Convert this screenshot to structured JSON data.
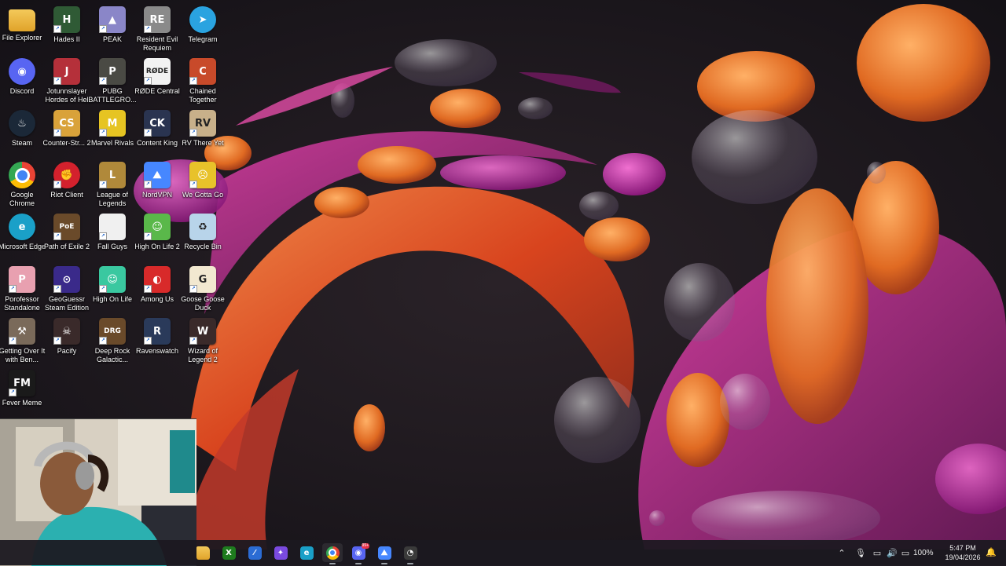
{
  "desktop": {
    "icons": [
      {
        "label": "File Explorer",
        "icon": "folder-icon",
        "color": "#e8b43a",
        "glyph": ""
      },
      {
        "label": "Hades II",
        "icon": "hades-icon",
        "color": "#2f5a35",
        "glyph": "H"
      },
      {
        "label": "PEAK",
        "icon": "peak-icon",
        "color": "#8a86c8",
        "glyph": "▲"
      },
      {
        "label": "Resident Evil Requiem",
        "icon": "resident-evil-icon",
        "color": "#8a8a8a",
        "glyph": "RE"
      },
      {
        "label": "Telegram",
        "icon": "telegram-icon",
        "color": "#2aa3e0",
        "glyph": "➤"
      },
      {
        "label": "Discord",
        "icon": "discord-icon",
        "color": "#5865f2",
        "glyph": "◉"
      },
      {
        "label": "Jotunnslayer Hordes of Hel",
        "icon": "jotunnslayer-icon",
        "color": "#b5303a",
        "glyph": "J"
      },
      {
        "label": "PUBG BATTLEGRO...",
        "icon": "pubg-icon",
        "color": "#4a4a44",
        "glyph": "P"
      },
      {
        "label": "RØDE Central",
        "icon": "rode-icon",
        "color": "#f2f2f2",
        "glyph": "RØDE"
      },
      {
        "label": "Chained Together",
        "icon": "chained-together-icon",
        "color": "#c84a2a",
        "glyph": "C"
      },
      {
        "label": "Steam",
        "icon": "steam-icon",
        "color": "#1b2838",
        "glyph": "♨"
      },
      {
        "label": "Counter-Str... 2",
        "icon": "counter-strike-icon",
        "color": "#d9a23a",
        "glyph": "CS"
      },
      {
        "label": "Marvel Rivals",
        "icon": "marvel-rivals-icon",
        "color": "#e6c422",
        "glyph": "M"
      },
      {
        "label": "Content King",
        "icon": "content-king-icon",
        "color": "#2a3450",
        "glyph": "CK"
      },
      {
        "label": "RV There Yet",
        "icon": "rv-there-yet-icon",
        "color": "#c8b08a",
        "glyph": "RV"
      },
      {
        "label": "Google Chrome",
        "icon": "chrome-icon",
        "color": "#ffffff",
        "glyph": ""
      },
      {
        "label": "Riot Client",
        "icon": "riot-client-icon",
        "color": "#d3212d",
        "glyph": "✊"
      },
      {
        "label": "League of Legends",
        "icon": "league-of-legends-icon",
        "color": "#b0893a",
        "glyph": "L"
      },
      {
        "label": "NordVPN",
        "icon": "nordvpn-icon",
        "color": "#4687ff",
        "glyph": "⛰"
      },
      {
        "label": "We Gotta Go",
        "icon": "we-gotta-go-icon",
        "color": "#e8c22a",
        "glyph": "☹"
      },
      {
        "label": "Microsoft Edge",
        "icon": "edge-icon",
        "color": "#1aa0c8",
        "glyph": "e"
      },
      {
        "label": "Path of Exile 2",
        "icon": "path-of-exile-icon",
        "color": "#6a4a2a",
        "glyph": "PoE"
      },
      {
        "label": "Fall Guys",
        "icon": "fall-guys-icon",
        "color": "#f0f0f0",
        "glyph": ""
      },
      {
        "label": "High On Life 2",
        "icon": "high-on-life-2-icon",
        "color": "#5ab84a",
        "glyph": "☺"
      },
      {
        "label": "Recycle Bin",
        "icon": "recycle-bin-icon",
        "color": "#b8d4ea",
        "glyph": "♻"
      },
      {
        "label": "Porofessor Standalone",
        "icon": "porofessor-icon",
        "color": "#e8a0b0",
        "glyph": "P"
      },
      {
        "label": "GeoGuessr Steam Edition",
        "icon": "geoguessr-icon",
        "color": "#3a2a8a",
        "glyph": "⊙"
      },
      {
        "label": "High On Life",
        "icon": "high-on-life-icon",
        "color": "#3ac8a0",
        "glyph": "☺"
      },
      {
        "label": "Among Us",
        "icon": "among-us-icon",
        "color": "#d82a2a",
        "glyph": "◐"
      },
      {
        "label": "Goose Goose Duck",
        "icon": "goose-goose-duck-icon",
        "color": "#f2e8d0",
        "glyph": "G"
      },
      {
        "label": "Getting Over It with Ben...",
        "icon": "getting-over-it-icon",
        "color": "#7a6a5a",
        "glyph": "⚒"
      },
      {
        "label": "Pacify",
        "icon": "pacify-icon",
        "color": "#3a2a2a",
        "glyph": "☠"
      },
      {
        "label": "Deep Rock Galactic...",
        "icon": "deep-rock-galactic-icon",
        "color": "#6a4a2a",
        "glyph": "DRG"
      },
      {
        "label": "Ravenswatch",
        "icon": "ravenswatch-icon",
        "color": "#2a3a5a",
        "glyph": "R"
      },
      {
        "label": "Wizard of Legend 2",
        "icon": "wizard-of-legend-icon",
        "color": "#3a2a2a",
        "glyph": "W"
      },
      {
        "label": "Fever Meme",
        "icon": "fever-meme-icon",
        "color": "#1a1a1a",
        "glyph": "FM"
      }
    ]
  },
  "taskbar": {
    "apps": [
      {
        "name": "File Explorer",
        "icon": "file-explorer-taskbar-icon",
        "color": "#e8b43a",
        "glyph": "",
        "running": false
      },
      {
        "name": "Xbox",
        "icon": "xbox-taskbar-icon",
        "color": "#1e7c1e",
        "glyph": "X",
        "running": false
      },
      {
        "name": "Visual Studio",
        "icon": "visual-studio-taskbar-icon",
        "color": "#2b6cd4",
        "glyph": "⁄",
        "running": false
      },
      {
        "name": "Copilot",
        "icon": "copilot-taskbar-icon",
        "color": "#7a4ae0",
        "glyph": "✦",
        "running": false
      },
      {
        "name": "Microsoft Edge",
        "icon": "edge-taskbar-icon",
        "color": "#1aa0c8",
        "glyph": "e",
        "running": false
      },
      {
        "name": "Google Chrome",
        "icon": "chrome-taskbar-icon",
        "color": "#e84a3a",
        "glyph": "◎",
        "running": true
      },
      {
        "name": "Discord",
        "icon": "discord-taskbar-icon",
        "color": "#5865f2",
        "glyph": "◉",
        "running": true,
        "badge": "99+"
      },
      {
        "name": "NordVPN",
        "icon": "nordvpn-taskbar-icon",
        "color": "#4687ff",
        "glyph": "⛰",
        "running": true
      },
      {
        "name": "OBS Studio",
        "icon": "obs-taskbar-icon",
        "color": "#3a3a3a",
        "glyph": "◔",
        "running": true
      }
    ],
    "tray": {
      "battery": "100%",
      "time": "5:47 PM",
      "date": "19/04/2026"
    }
  }
}
